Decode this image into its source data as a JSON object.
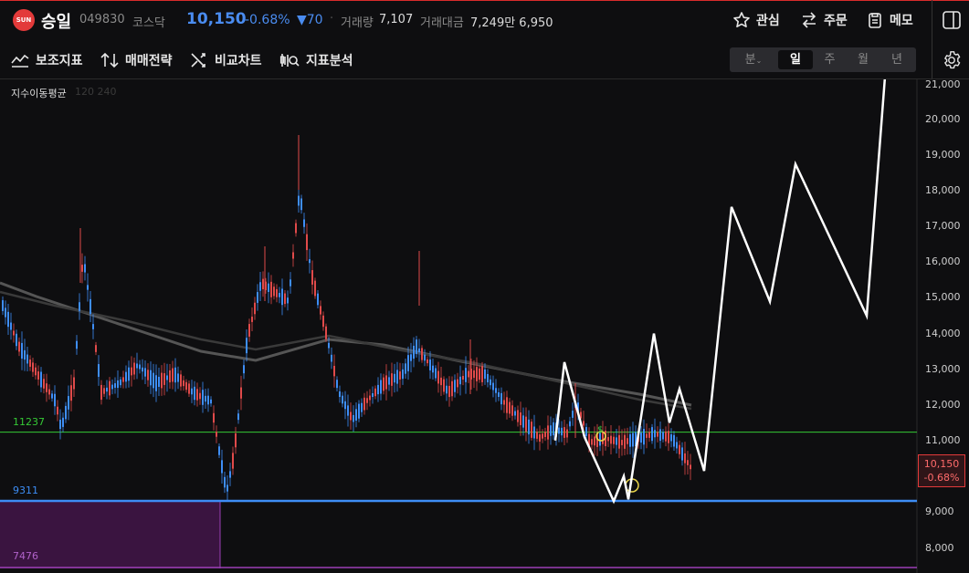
{
  "header": {
    "logo_text": "SUN",
    "name": "승일",
    "code": "049830",
    "market": "코스닥",
    "price": "10,150",
    "change_pct": "-0.68%",
    "change_abs": "▼70",
    "volume_label": "거래량",
    "volume_value": "7,107",
    "amount_label": "거래대금",
    "amount_value": "7,249만 6,950",
    "actions": {
      "watch": "관심",
      "order": "주문",
      "memo": "메모"
    }
  },
  "toolbar": {
    "tools": [
      "보조지표",
      "매매전략",
      "비교차트",
      "지표분석"
    ],
    "periods": [
      "분",
      "일",
      "주",
      "월",
      "년"
    ],
    "selected_period": "일"
  },
  "chart": {
    "indicator_label": "지수이동평균",
    "indicator_params": "120 240",
    "levels": {
      "green": "11237",
      "blue": "9311",
      "purple": "7476"
    },
    "y_ticks": [
      "21,000",
      "20,000",
      "19,000",
      "18,000",
      "17,000",
      "16,000",
      "15,000",
      "14,000",
      "13,000",
      "12,000",
      "11,000",
      "9,000",
      "8,000"
    ],
    "current_price": "10,150",
    "current_change": "-0.68%",
    "colors": {
      "up": "#e04a4a",
      "down": "#3e8ef7",
      "green_line": "#35c935",
      "blue_line": "#3d8df5",
      "purple_zone": "#3a1440"
    }
  },
  "chart_data": {
    "type": "candlestick",
    "y_ticks": [
      8000,
      9000,
      11000,
      12000,
      13000,
      14000,
      15000,
      16000,
      17000,
      18000,
      19000,
      20000,
      21000
    ],
    "horizontal_levels": [
      11237,
      9311,
      7476
    ],
    "current_price": 10150,
    "projection_path": [
      11000,
      13200,
      11100,
      9300,
      10000,
      9350,
      14000,
      11500,
      12450,
      10150,
      17550,
      14900,
      18750,
      14500,
      21200
    ]
  }
}
